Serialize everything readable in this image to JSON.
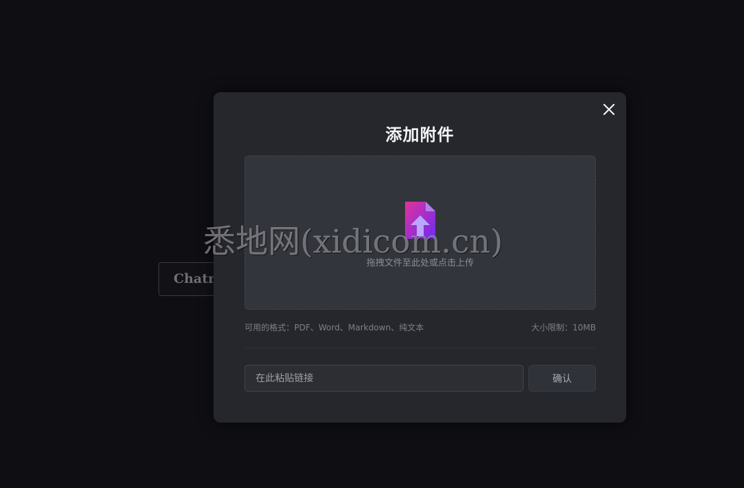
{
  "background": {
    "button_label": "Chatm"
  },
  "modal": {
    "title": "添加附件",
    "dropzone": {
      "text": "拖拽文件至此处或点击上传"
    },
    "formats_text": "可用的格式：PDF、Word、Markdown、纯文本",
    "size_limit_text": "大小限制：10MB",
    "link_input": {
      "placeholder": "在此粘贴链接",
      "value": ""
    },
    "confirm_label": "确认"
  },
  "watermark": "悉地网(xidicom.cn)",
  "icons": {
    "close": "close-icon",
    "upload": "file-upload-icon"
  },
  "colors": {
    "page_bg": "#0e0e13",
    "modal_bg": "#26272c",
    "dropzone_bg": "#33353c",
    "icon_gradient_start": "#d9309c",
    "icon_gradient_end": "#7a2cf0"
  }
}
